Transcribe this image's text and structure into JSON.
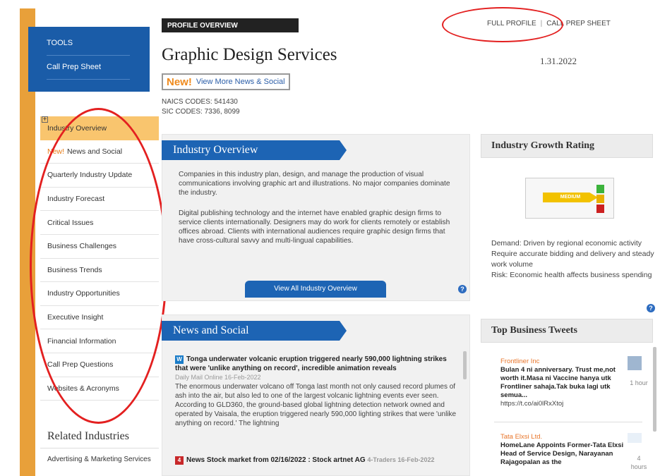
{
  "left_nav": {
    "tools_label": "TOOLS",
    "call_prep_label": "Call Prep Sheet",
    "new_badge": "New!",
    "items": [
      "Industry Overview",
      "News and Social",
      "Quarterly Industry Update",
      "Industry Forecast",
      "Critical Issues",
      "Business Challenges",
      "Business Trends",
      "Industry Opportunities",
      "Executive Insight",
      "Financial Information",
      "Call Prep Questions",
      "Websites & Acronyms"
    ],
    "plus_glyph": "+",
    "related_title": "Related Industries",
    "related_items": [
      "Advertising & Marketing Services"
    ]
  },
  "header": {
    "tag": "PROFILE OVERVIEW",
    "title": "Graphic Design Services",
    "new_badge": "New!",
    "view_more": "View More News & Social",
    "naics": "NAICS CODES: 541430",
    "sic": "SIC CODES: 7336, 8099",
    "full_profile": "FULL PROFILE",
    "separator": "|",
    "call_prep_sheet": "CALL PREP SHEET",
    "date": "1.31.2022"
  },
  "overview": {
    "title": "Industry Overview",
    "p1": "Companies in this industry plan, design, and manage the production of visual communications involving graphic art and illustrations. No major companies dominate the industry.",
    "p2": "Digital publishing technology and the internet have enabled graphic design firms to service clients internationally. Designers may do work for clients remotely or establish offices abroad. Clients with international audiences require graphic design firms that have cross-cultural savvy and multi-lingual capabilities.",
    "button": "View All Industry Overview",
    "help": "?"
  },
  "growth": {
    "title": "Industry Growth Rating",
    "rating": "MEDIUM",
    "demand": "Demand: Driven by regional economic activity",
    "require": "Require accurate bidding and delivery and steady work volume",
    "risk": "Risk: Economic health affects business spending",
    "help": "?"
  },
  "news": {
    "title": "News and Social",
    "items": [
      {
        "icon": "W",
        "headline": "Tonga underwater volcanic eruption triggered nearly 590,000 lightning strikes that were 'unlike anything on record', incredible animation reveals",
        "source": "Daily Mail Online  16-Feb-2022",
        "body": "The enormous underwater volcano off Tonga last month not only caused record plumes of ash into the air, but also led to one of the largest volcanic lightning events ever seen. According to GLD360, the ground-based global lightning detection network owned and operated by Vaisala, the eruption triggered nearly 590,000 lighting strikes that were 'unlike anything on record.' The lightning"
      },
      {
        "icon": "4",
        "headline": "News Stock market from 02/16/2022 : Stock artnet AG",
        "source": "4-Traders  16-Feb-2022",
        "body": ""
      }
    ]
  },
  "tweets": {
    "title": "Top Business Tweets",
    "items": [
      {
        "company": "Frontliner Inc",
        "text": "Bulan 4 ni anniversary. Trust me,not worth it.Masa ni Vaccine hanya utk Frontliner sahaja.Tak buka lagi utk semua...",
        "url": "https://t.co/ai0lRxXtoj",
        "time": "1 hour"
      },
      {
        "company": "Tata Elxsi Ltd.",
        "text": "HomeLane Appoints Former-Tata Elxsi Head of Service Design, Narayanan Rajagopalan as the",
        "url": "",
        "time": "4 hours"
      }
    ]
  },
  "colors": {
    "accent_blue": "#1d64b4",
    "nav_orange": "#e8a03a",
    "active_nav": "#f9c56e",
    "annotation_red": "#e32020"
  }
}
